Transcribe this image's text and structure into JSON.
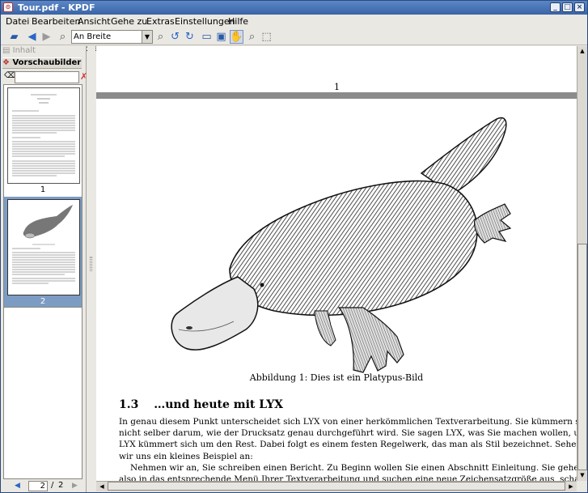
{
  "window": {
    "title": "Tour.pdf - KPDF"
  },
  "menu": [
    "Datei",
    "Bearbeiten",
    "Ansicht",
    "Gehe zu",
    "Extras",
    "Einstellungen",
    "Hilfe"
  ],
  "toolbar": {
    "zoom_value": "An Breite anpassen"
  },
  "sidebar": {
    "tab_contents": "Inhalt",
    "tab_thumbnails": "Vorschaubilder",
    "search_placeholder": "",
    "thumb1_label": "1",
    "thumb2_label": "2",
    "page_current": "2",
    "page_separator": "/",
    "page_total": "2"
  },
  "document": {
    "page1_number": "1",
    "caption": "Abbildung 1: Dies ist ein Platypus-Bild",
    "section_number": "1.3",
    "section_title": "…und heute mit LYX",
    "para1_line1": "In genau diesem Punkt unterscheidet sich LYX von einer herkömmlichen Textverarbeitung. Sie kümmern sich",
    "para1_line2": "nicht selber darum, wie der Drucksatz genau durchgeführt wird. Sie sagen LYX, was Sie machen wollen, und",
    "para1_line3": "LYX kümmert sich um den Rest. Dabei folgt es einem festen Regelwerk, das man als Stil bezeichnet. Sehen",
    "para1_line4": "wir uns ein kleines Beispiel an:",
    "para2_line1": "Nehmen wir an, Sie schreiben einen Bericht. Zu Beginn wollen Sie einen Abschnitt Einleitung. Sie gehen",
    "para2_line2": "also in das entsprechende Menü Ihrer Textverarbeitung und suchen eine neue Zeichensatzgröße aus, schalten"
  }
}
